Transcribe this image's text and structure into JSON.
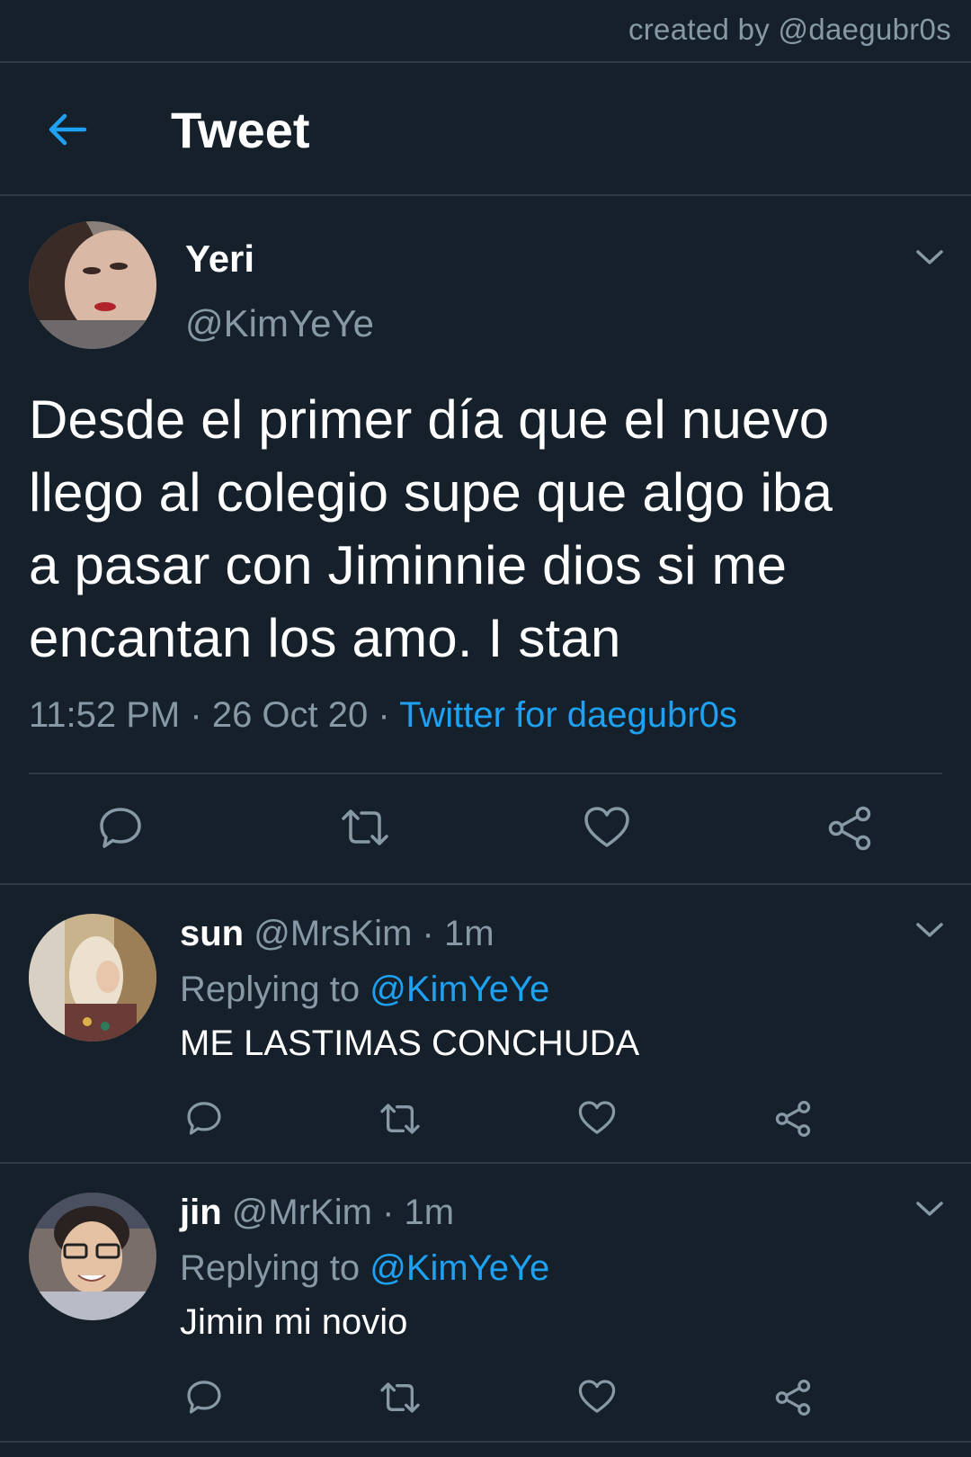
{
  "credit": "created by @daegubr0s",
  "header": {
    "title": "Tweet",
    "back_icon": "arrow-left-icon"
  },
  "colors": {
    "background": "#15202b",
    "accent": "#1da1f2",
    "muted": "#8899a6",
    "divider": "#2c3a47"
  },
  "main_tweet": {
    "name": "Yeri",
    "handle": "@KimYeYe",
    "text_lines": [
      "Desde el primer día que el nuevo",
      "llego al colegio supe que algo iba",
      "a pasar con Jiminnie dios si me",
      "encantan los amo. I stan"
    ],
    "time": "11:52 PM",
    "date": "26 Oct 20",
    "separator": "·",
    "source": "Twitter for daegubr0s"
  },
  "replies": [
    {
      "name": "sun",
      "handle": "@MrsKim",
      "time": "1m",
      "replying_label": "Replying to",
      "replying_to": "@KimYeYe",
      "text": "ME LASTIMAS CONCHUDA"
    },
    {
      "name": "jin",
      "handle": "@MrKim",
      "time": "1m",
      "replying_label": "Replying to",
      "replying_to": "@KimYeYe",
      "text": "Jimin mi novio"
    }
  ],
  "actions": [
    "reply-icon",
    "retweet-icon",
    "like-icon",
    "share-icon"
  ]
}
